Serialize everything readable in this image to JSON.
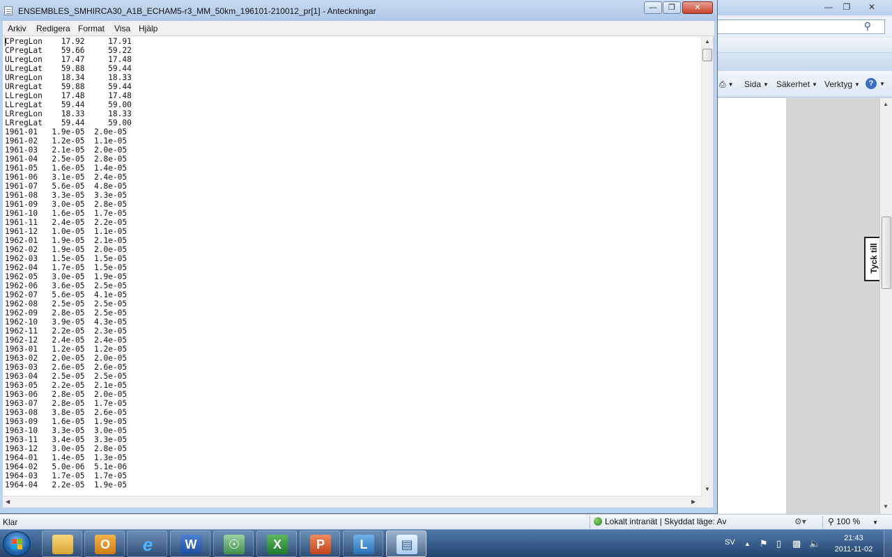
{
  "browser": {
    "command_bar": {
      "page_label": "Sida",
      "security_label": "Säkerhet",
      "tools_label": "Verktyg",
      "help_label": "?"
    },
    "feedback_tab": "Tyck till",
    "status": {
      "text": "Klar",
      "zone": "Lokalt intranät | Skyddat läge: Av",
      "zoom": "100 %"
    }
  },
  "notepad": {
    "title": "ENSEMBLES_SMHIRCA30_A1B_ECHAM5-r3_MM_50km_196101-210012_pr[1] - Anteckningar",
    "menu": [
      "Arkiv",
      "Redigera",
      "Format",
      "Visa",
      "Hjälp"
    ],
    "content": "CPregLon    17.92     17.91\nCPregLat    59.66     59.22\nULregLon    17.47     17.48\nULregLat    59.88     59.44\nURregLon    18.34     18.33\nURregLat    59.88     59.44\nLLregLon    17.48     17.48\nLLregLat    59.44     59.00\nLRregLon    18.33     18.33\nLRregLat    59.44     59.00\n1961-01   1.9e-05  2.0e-05\n1961-02   1.2e-05  1.1e-05\n1961-03   2.1e-05  2.0e-05\n1961-04   2.5e-05  2.8e-05\n1961-05   1.6e-05  1.4e-05\n1961-06   3.1e-05  2.4e-05\n1961-07   5.6e-05  4.8e-05\n1961-08   3.3e-05  3.3e-05\n1961-09   3.0e-05  2.8e-05\n1961-10   1.6e-05  1.7e-05\n1961-11   2.4e-05  2.2e-05\n1961-12   1.0e-05  1.1e-05\n1962-01   1.9e-05  2.1e-05\n1962-02   1.9e-05  2.0e-05\n1962-03   1.5e-05  1.5e-05\n1962-04   1.7e-05  1.5e-05\n1962-05   3.0e-05  1.9e-05\n1962-06   3.6e-05  2.5e-05\n1962-07   5.6e-05  4.1e-05\n1962-08   2.5e-05  2.5e-05\n1962-09   2.8e-05  2.5e-05\n1962-10   3.9e-05  4.3e-05\n1962-11   2.2e-05  2.3e-05\n1962-12   2.4e-05  2.4e-05\n1963-01   1.2e-05  1.2e-05\n1963-02   2.0e-05  2.0e-05\n1963-03   2.6e-05  2.6e-05\n1963-04   2.5e-05  2.5e-05\n1963-05   2.2e-05  2.1e-05\n1963-06   2.8e-05  2.0e-05\n1963-07   2.8e-05  1.7e-05\n1963-08   3.8e-05  2.6e-05\n1963-09   1.6e-05  1.9e-05\n1963-10   3.3e-05  3.0e-05\n1963-11   3.4e-05  3.3e-05\n1963-12   3.0e-05  2.8e-05\n1964-01   1.4e-05  1.3e-05\n1964-02   5.0e-06  5.1e-06\n1964-03   1.7e-05  1.7e-05\n1964-04   2.2e-05  1.9e-05"
  },
  "taskbar": {
    "apps": [
      "explorer",
      "outlook",
      "internet-explorer",
      "word",
      "security-app",
      "excel",
      "powerpoint",
      "lync",
      "notepad"
    ],
    "tray_language": "SV",
    "clock_time": "21:43",
    "clock_date": "2011-11-02"
  },
  "colors": {
    "taskbar": "#24456f",
    "close_button": "#c6432b",
    "window_frame": "#bcd3ee"
  }
}
